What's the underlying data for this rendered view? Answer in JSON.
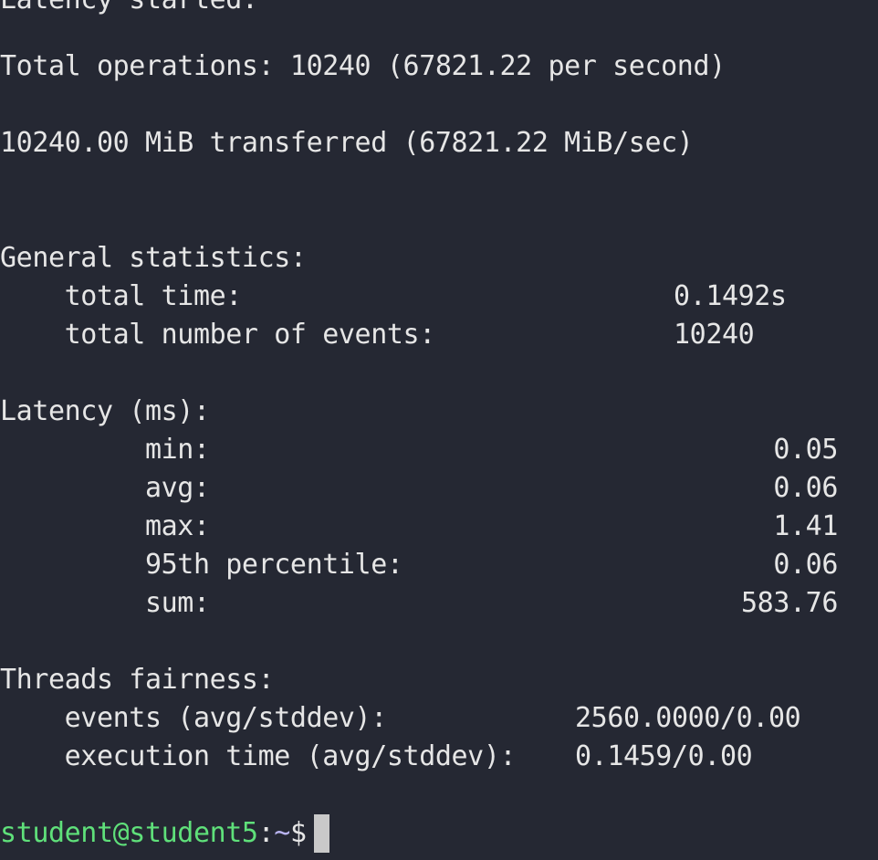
{
  "terminal": {
    "partial_line": "Latency started.",
    "total_operations": "Total operations: 10240 (67821.22 per second)",
    "transferred": "10240.00 MiB transferred (67821.22 MiB/sec)",
    "general_statistics": {
      "header": "General statistics:",
      "total_time_label": "    total time:",
      "total_time_value": "0.1492s",
      "total_events_label": "    total number of events:",
      "total_events_value": "10240"
    },
    "latency": {
      "header": "Latency (ms):",
      "min_label": "         min:",
      "min_value": "0.05",
      "avg_label": "         avg:",
      "avg_value": "0.06",
      "max_label": "         max:",
      "max_value": "1.41",
      "p95_label": "         95th percentile:",
      "p95_value": "0.06",
      "sum_label": "         sum:",
      "sum_value": "583.76"
    },
    "threads_fairness": {
      "header": "Threads fairness:",
      "events_label": "    events (avg/stddev):",
      "events_value": "2560.0000/0.00",
      "exec_label": "    execution time (avg/stddev):",
      "exec_value": "0.1459/0.00"
    },
    "prompt": {
      "user_host": "student@student5",
      "separator": ":",
      "path": "~",
      "symbol": "$"
    }
  }
}
